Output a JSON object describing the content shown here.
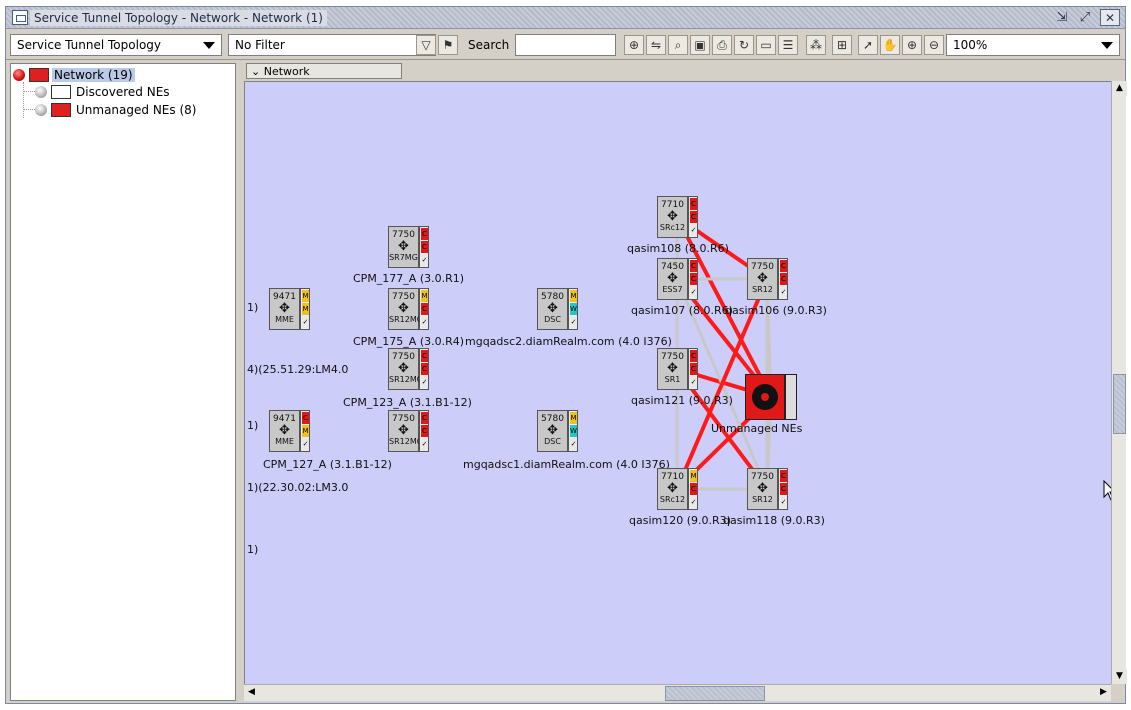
{
  "window": {
    "title": "Service Tunnel Topology - Network - Network (1)"
  },
  "toolbar": {
    "view_select": "Service Tunnel Topology",
    "filter_select": "No Filter",
    "search_label": "Search",
    "search_value": "",
    "zoom": "100%"
  },
  "tree": {
    "items": [
      {
        "label": "Network (19)",
        "status": "critical"
      },
      {
        "label": "Discovered NEs",
        "status": "none"
      },
      {
        "label": "Unmanaged NEs (8)",
        "status": "none"
      }
    ]
  },
  "canvas": {
    "breadcrumb": "Network",
    "left_edge_labels": [
      "1)",
      "4)(25.51.29:LM4.0",
      "1)",
      "1)(22.30.02:LM3.0",
      "1)"
    ],
    "nodes": [
      {
        "model": "7750",
        "type": "SR7MG",
        "label": "CPM_177_A (3.0.R1)",
        "status": [
          "C",
          "C",
          "✓"
        ]
      },
      {
        "model": "9471",
        "type": "MME",
        "label": "",
        "status": [
          "M",
          "M",
          "✓"
        ]
      },
      {
        "model": "7750",
        "type": "SR12MG",
        "label": "CPM_175_A (3.0.R4)",
        "status": [
          "M",
          "C",
          "✓"
        ]
      },
      {
        "model": "5780",
        "type": "DSC",
        "label": "mgqadsc2.diamRealm.com (4.0 I376)",
        "status": [
          "M",
          "W",
          "✓"
        ]
      },
      {
        "model": "7750",
        "type": "SR12MG",
        "label": "CPM_123_A (3.1.B1-12)",
        "status": [
          "C",
          "C",
          "✓"
        ]
      },
      {
        "model": "9471",
        "type": "MME",
        "label": "",
        "status": [
          "C",
          "M",
          "✓"
        ]
      },
      {
        "model": "7750",
        "type": "SR12MG",
        "label": "CPM_127_A (3.1.B1-12)",
        "status": [
          "C",
          "C",
          "✓"
        ]
      },
      {
        "model": "5780",
        "type": "DSC",
        "label": "mgqadsc1.diamRealm.com (4.0 I376)",
        "status": [
          "M",
          "W",
          "✓"
        ]
      },
      {
        "model": "7710",
        "type": "SRc12",
        "label": "qasim108 (8.0.R6)",
        "status": [
          "C",
          "C",
          "✓"
        ]
      },
      {
        "model": "7450",
        "type": "ESS7",
        "label": "qasim107 (8.0.R6)",
        "status": [
          "C",
          "C",
          "✓"
        ]
      },
      {
        "model": "7750",
        "type": "SR12",
        "label": "qasim106 (9.0.R3)",
        "status": [
          "C",
          "C",
          "✓"
        ]
      },
      {
        "model": "7750",
        "type": "SR1",
        "label": "qasim121 (9.0.R3)",
        "status": [
          "C",
          "C",
          "✓"
        ]
      },
      {
        "model": "7710",
        "type": "SRc12",
        "label": "qasim120 (9.0.R3)",
        "status": [
          "M",
          "C",
          "✓"
        ]
      },
      {
        "model": "7750",
        "type": "SR12",
        "label": "qasim118 (9.0.R3)",
        "status": [
          "C",
          "C",
          "✓"
        ]
      }
    ],
    "unmanaged_label": "Unmanaged NEs"
  },
  "colors": {
    "canvas_bg": "#cdcdf9",
    "critical": "#e01818",
    "major": "#f0c020",
    "warning": "#20c8c8",
    "link_alarm": "#ff1a1a",
    "link_normal": "#c8c8c8"
  }
}
